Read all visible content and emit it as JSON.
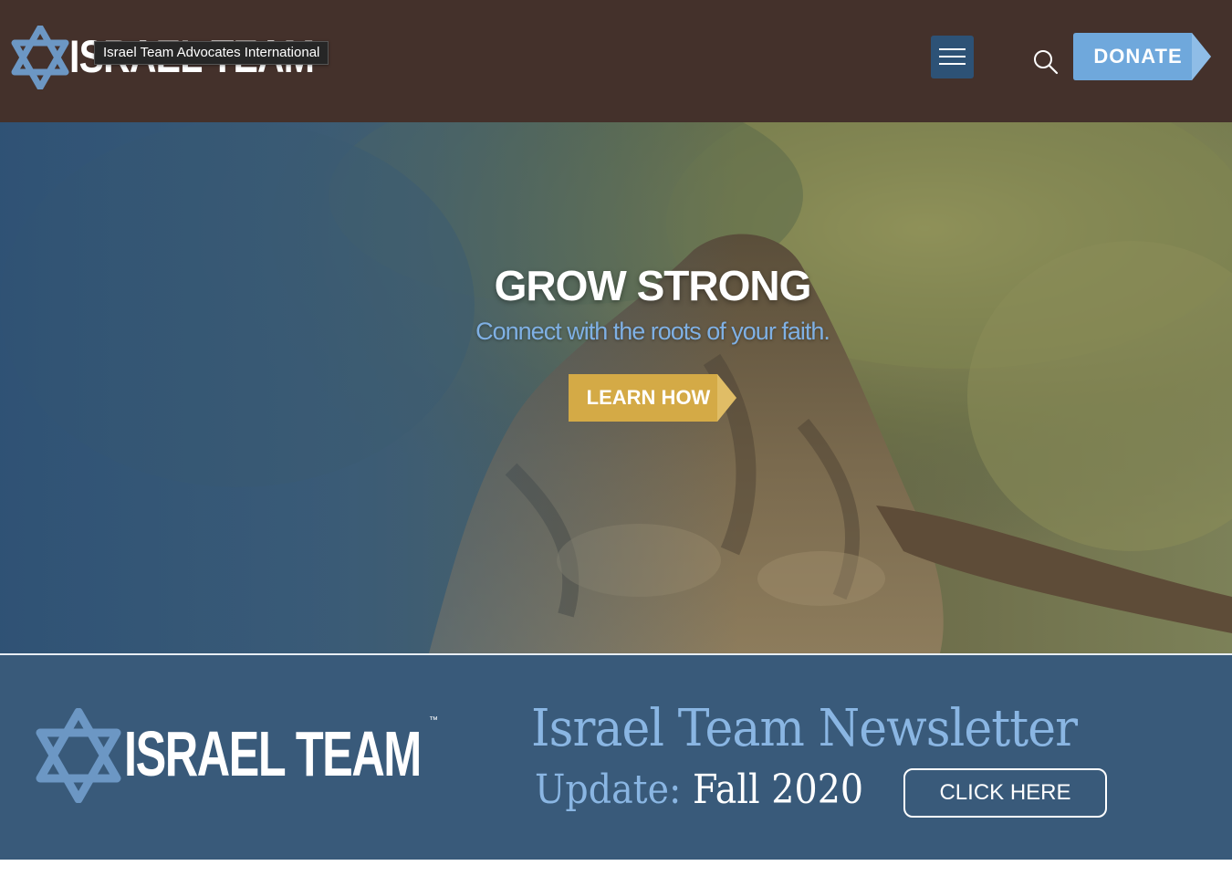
{
  "header": {
    "logo_text": "ISRAEL TEAM",
    "logo_tooltip": "Israel Team Advocates International",
    "menu_icon": "hamburger-menu-icon",
    "search_icon": "search-icon",
    "donate_label": "DONATE"
  },
  "hero": {
    "title": "GROW STRONG",
    "subtitle": "Connect with the roots of your faith.",
    "cta_label": "LEARN HOW"
  },
  "newsletter": {
    "logo_text": "ISRAEL TEAM",
    "trademark": "™",
    "title": "Israel Team Newsletter",
    "update_label": "Update:",
    "season": "Fall 2020",
    "cta_label": "CLICK HERE"
  },
  "colors": {
    "header_bg": "#44312b",
    "accent_blue": "#6fa8dc",
    "donate_bg": "#6fa8dc",
    "learn_bg": "#d4aa46",
    "newsletter_bg": "#395a7a",
    "menu_bg": "#2d5276"
  }
}
